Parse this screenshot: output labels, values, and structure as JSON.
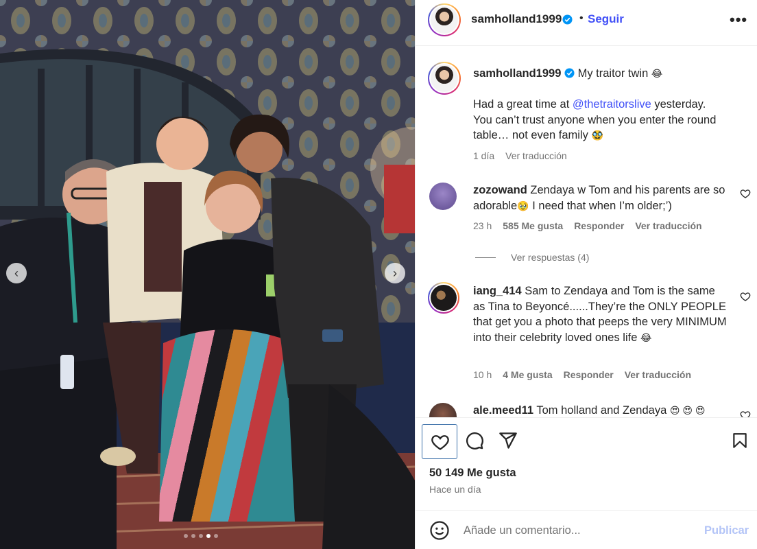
{
  "post": {
    "author": "samholland1999",
    "verified": true,
    "follow_label": "Seguir",
    "separator": "•",
    "more_label": "•••",
    "caption_title": "My traitor twin",
    "caption_title_emoji": "😂",
    "caption_before_mention": "Had a great time at ",
    "caption_mention": "@thetraitorslive",
    "caption_after_mention": " yesterday. You can’t trust anyone when you enter the round table… not even family",
    "caption_end_emoji": "🥸",
    "caption_time": "1 día",
    "caption_translate": "Ver traducción"
  },
  "photo": {
    "carousel_prev": "‹",
    "carousel_next": "›",
    "slide_count": 5,
    "active_slide": 4
  },
  "comments": [
    {
      "user": "zozowand",
      "text_before_emoji": "Zendaya w Tom and his parents are so adorable",
      "emoji": "🥹",
      "text_after_emoji": " I need that when I’m older;’)",
      "time": "23 h",
      "likes": "585 Me gusta",
      "reply": "Responder",
      "translate": "Ver traducción",
      "view_replies": "Ver respuestas (4)"
    },
    {
      "user": "iang_414",
      "text": "Sam to Zendaya and Tom is the same as Tina to Beyoncé......They’re the ONLY PEOPLE that get you a photo that peeps the very MINIMUM into their celebrity loved ones life",
      "emoji": "😂",
      "time": "10 h",
      "likes": "4 Me gusta",
      "reply": "Responder",
      "translate": "Ver traducción"
    },
    {
      "user": "ale.meed11",
      "text": "Tom holland and Zendaya",
      "emoji": "😍 😍 😍"
    }
  ],
  "actions": {
    "likes": "50 149 Me gusta",
    "posted": "Hace un día"
  },
  "add_comment": {
    "placeholder": "Añade un comentario...",
    "publish": "Publicar"
  },
  "colors": {
    "link_blue": "#4150f7",
    "publish_disabled": "#b3c4f7",
    "verified_blue": "#0095f6",
    "muted": "#737373"
  },
  "icons": [
    "heart-icon",
    "comment-icon",
    "share-icon",
    "bookmark-icon",
    "emoji-icon",
    "verified-badge-icon",
    "more-options-icon"
  ]
}
